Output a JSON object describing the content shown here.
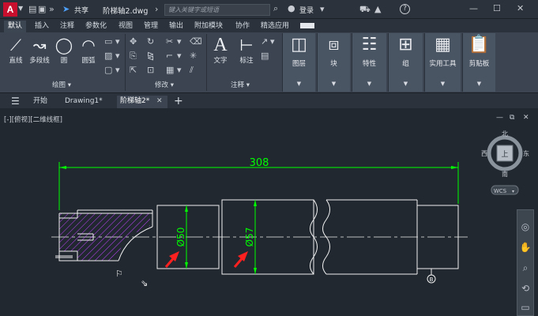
{
  "app": {
    "logo": "A",
    "share_label": "共享",
    "doc_title": "阶梯轴2.dwg",
    "search_placeholder": "键入关键字或短语",
    "login_label": "登录",
    "help_label": "?"
  },
  "ribbon_tabs": [
    "默认",
    "插入",
    "注释",
    "参数化",
    "视图",
    "管理",
    "输出",
    "附加模块",
    "协作",
    "精选应用"
  ],
  "active_ribbon_tab": 0,
  "draw_panel": {
    "title": "绘图",
    "tools": [
      "直线",
      "多段线",
      "圆",
      "圆弧"
    ]
  },
  "modify_panel": {
    "title": "修改"
  },
  "annotation_panel": {
    "title": "注释",
    "tools": [
      "文字",
      "标注"
    ]
  },
  "ribbon_buttons": [
    "图层",
    "块",
    "特性",
    "组",
    "实用工具",
    "剪贴板"
  ],
  "file_tabs": {
    "start": "开始",
    "tabs": [
      "Drawing1*",
      "阶梯轴2*"
    ],
    "active": 1
  },
  "viewport": {
    "label": "[-][俯视][二维线框]",
    "viewcube": {
      "north": "北",
      "south": "南",
      "east": "东",
      "west": "西",
      "face": "上",
      "wcs": "WCS"
    }
  },
  "drawing": {
    "dim_length": "308",
    "dim_d1": "Ø50",
    "dim_d2": "Ø57",
    "balloon": "B"
  },
  "colors": {
    "dimension": "#00ff00",
    "hatch": "#c040ff",
    "arrow": "#ff2020",
    "geometry": "#f0f0f0",
    "background": "#212830"
  }
}
